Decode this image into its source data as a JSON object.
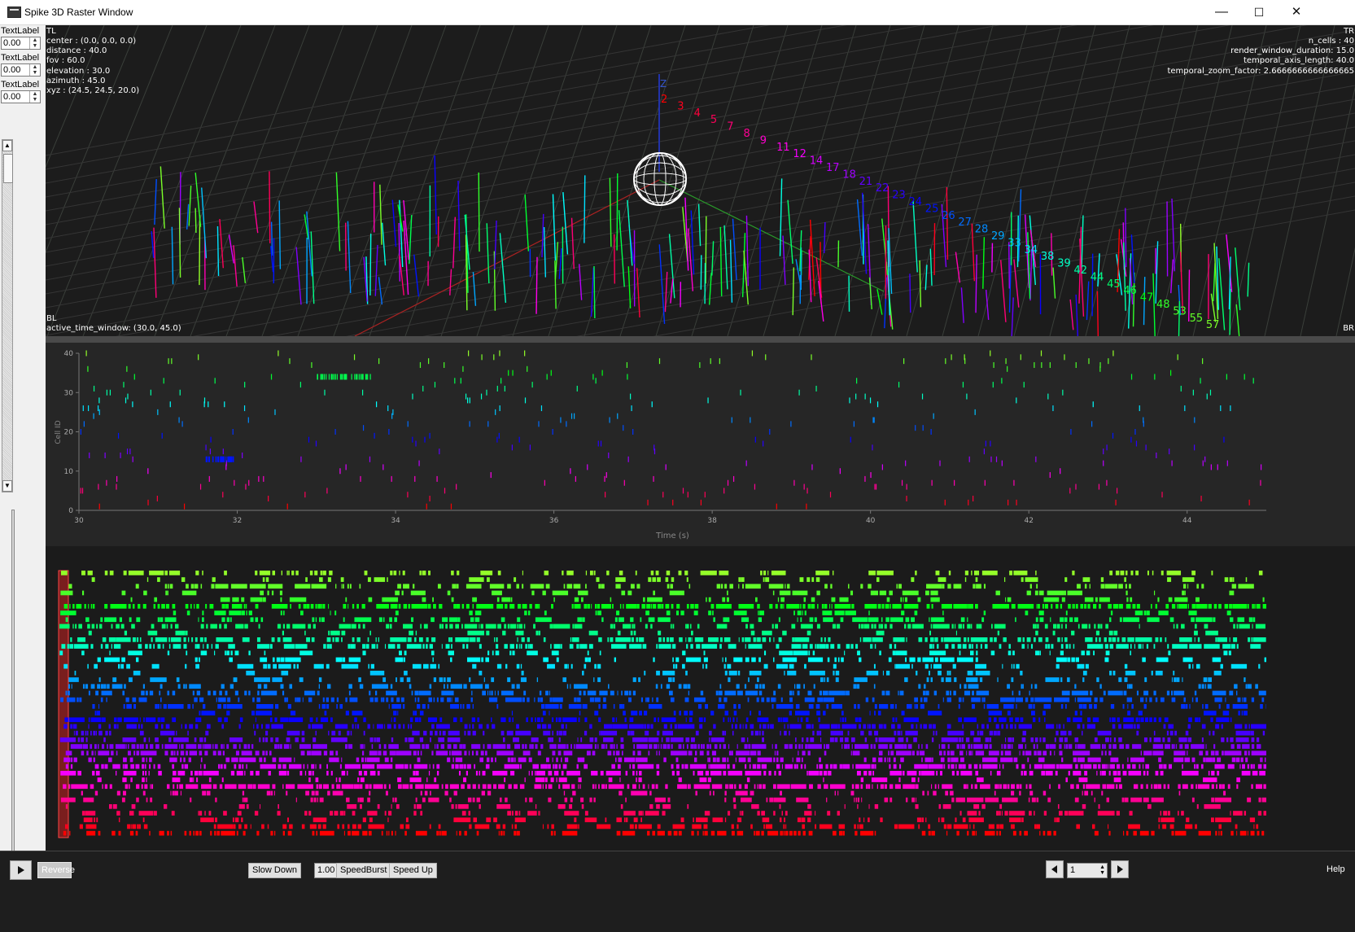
{
  "window": {
    "title": "Spike 3D Raster Window",
    "minimize": "—",
    "maximize": "☐",
    "close": "✕"
  },
  "left_panel": {
    "labels": [
      "TextLabel",
      "TextLabel",
      "TextLabel"
    ],
    "spin_values": [
      "0.00",
      "0.00",
      "0.00"
    ]
  },
  "view3d": {
    "tl_tag": "TL",
    "tl_lines": [
      "center : (0.0, 0.0, 0.0)",
      "distance : 40.0",
      "fov : 60.0",
      "elevation : 30.0",
      "azimuth : 45.0",
      "xyz : (24.5, 24.5, 20.0)"
    ],
    "tr_tag": "TR",
    "tr_lines": [
      "n_cells : 40",
      "render_window_duration: 15.0",
      "temporal_axis_length: 40.0",
      "temporal_zoom_factor: 2.6666666666666665"
    ],
    "bl_tag": "BL",
    "bl_line": "active_time_window: (30.0, 45.0)",
    "br_tag": "BR",
    "axis_z_label": "Z",
    "cell_labels": [
      "2",
      "3",
      "4",
      "5",
      "7",
      "8",
      "9",
      "11",
      "12",
      "14",
      "17",
      "18",
      "21",
      "22",
      "23",
      "24",
      "25",
      "26",
      "27",
      "28",
      "29",
      "33",
      "34",
      "38",
      "39",
      "42",
      "44",
      "45",
      "46",
      "47",
      "48",
      "53",
      "55",
      "57"
    ]
  },
  "raster2d": {
    "ylabel": "Cell ID",
    "xlabel": "Time (s)",
    "yticks": [
      "0",
      "10",
      "20",
      "30",
      "40"
    ],
    "xticks": [
      "30",
      "32",
      "34",
      "36",
      "38",
      "40",
      "42",
      "44"
    ]
  },
  "controls": {
    "reverse": "Reverse",
    "slow_down": "Slow Down",
    "speed": "1.00",
    "speed_burst": "SpeedBurst",
    "speed_up": "Speed Up",
    "page": "1",
    "help": "Help"
  },
  "chart_data": {
    "type": "scatter",
    "xlabel": "Time (s)",
    "ylabel": "Cell ID",
    "xlim": [
      30,
      45
    ],
    "ylim": [
      0,
      40
    ],
    "n_cells": 40
  }
}
